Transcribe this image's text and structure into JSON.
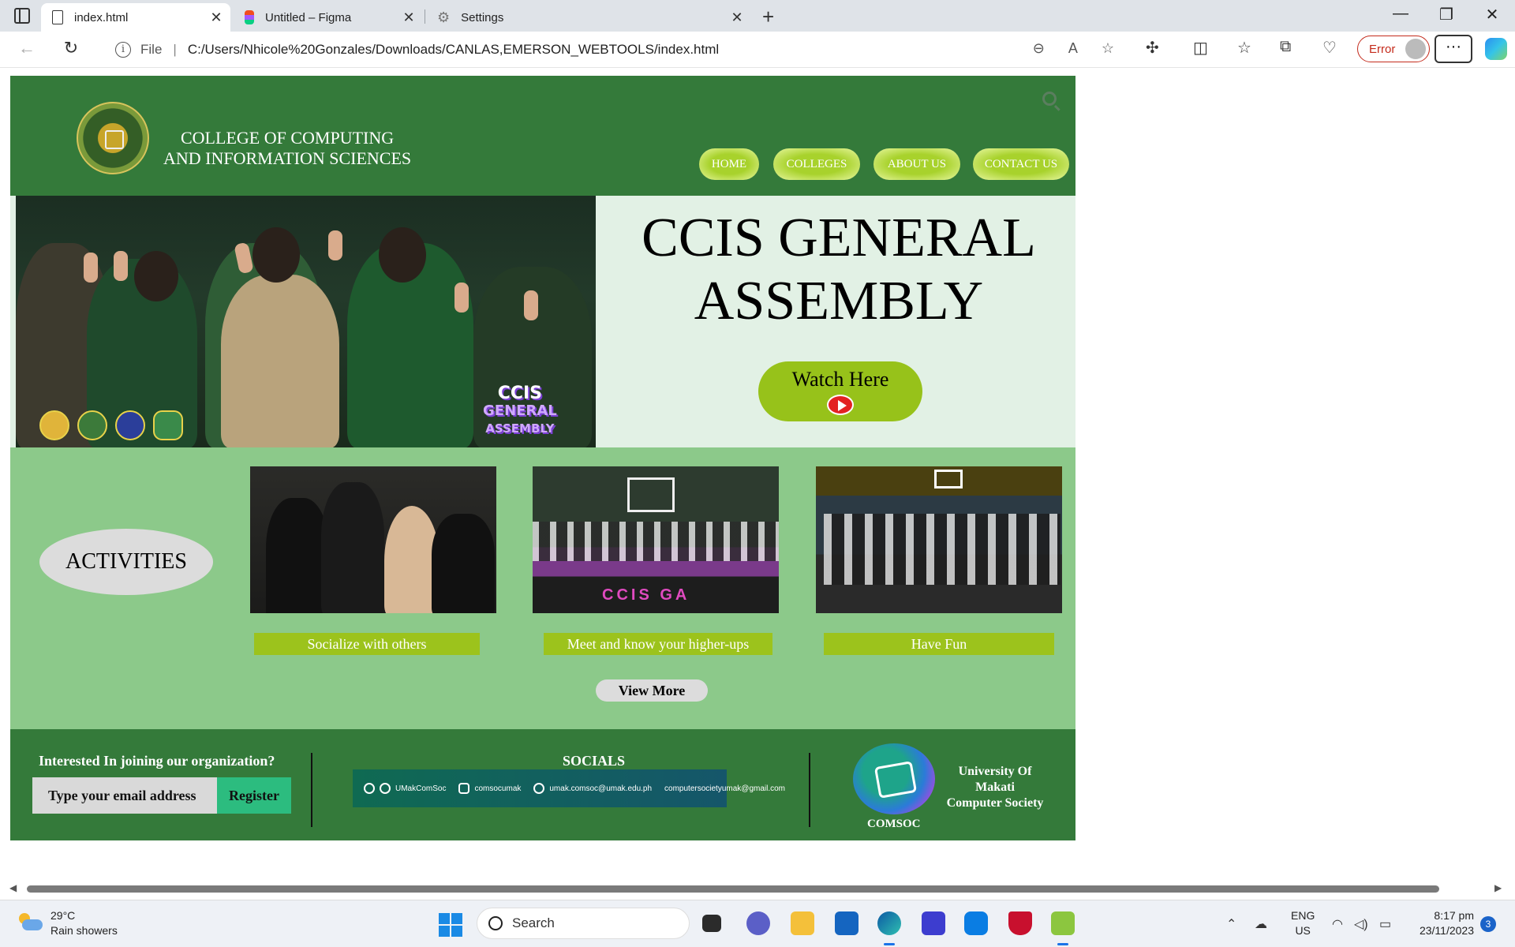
{
  "browser": {
    "tabs": [
      {
        "label": "index.html",
        "icon": "file-icon",
        "active": true
      },
      {
        "label": "Untitled – Figma",
        "icon": "figma-icon",
        "active": false
      },
      {
        "label": "Settings",
        "icon": "gear-icon",
        "active": false
      }
    ],
    "address": {
      "file_label": "File",
      "url": "C:/Users/Nhicole%20Gonzales/Downloads/CANLAS,EMERSON_WEBTOOLS/index.html"
    },
    "error_label": "Error"
  },
  "site": {
    "header": {
      "college_line1": "COLLEGE OF COMPUTING",
      "college_line2": "AND INFORMATION SCIENCES",
      "nav": [
        "HOME",
        "COLLEGES",
        "ABOUT US",
        "CONTACT US"
      ]
    },
    "hero": {
      "title_line1": "CCIS GENERAL",
      "title_line2": "ASSEMBLY",
      "watch_label": "Watch Here",
      "badge_line1": "CCIS",
      "badge_line2": "GENERAL",
      "badge_line3": "ASSEMBLY"
    },
    "activities": {
      "heading": "ACTIVITIES",
      "captions": [
        "Socialize with others",
        "Meet and know your higher-ups",
        "Have Fun"
      ],
      "view_more": "View More",
      "banner_text": "CCIS GA"
    },
    "footer": {
      "join_question": "Interested In joining our organization?",
      "email_placeholder": "Type your email address",
      "register_label": "Register",
      "socials_title": "SOCIALS",
      "social_items": [
        "UMakComSoc",
        "comsocumak",
        "umak.comsoc@umak.edu.ph",
        "computersocietyumak@gmail.com"
      ],
      "comsoc_label": "COMSOC",
      "umak_line1": "University Of",
      "umak_line2": "Makati",
      "umak_line3": "Computer Society"
    }
  },
  "taskbar": {
    "weather_temp": "29°C",
    "weather_desc": "Rain showers",
    "search_label": "Search",
    "lang1": "ENG",
    "lang2": "US",
    "time": "8:17 pm",
    "date": "23/11/2023",
    "notifications": "3"
  },
  "colors": {
    "header_green": "#347a3a",
    "activity_green": "#8cc98a",
    "lime": "#97c21a",
    "hero_bg": "#e2f1e5"
  }
}
